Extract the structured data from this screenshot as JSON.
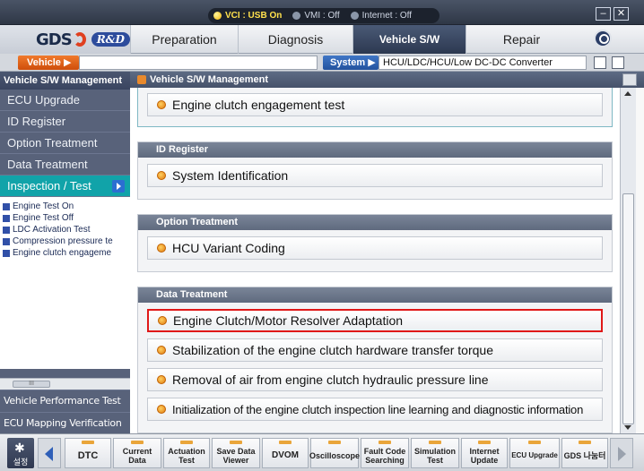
{
  "titlebar": {
    "vci": "VCI : USB On",
    "vmi": "VMI : Off",
    "internet": "Internet : Off",
    "minimize": "–",
    "close": "✕"
  },
  "menubar": {
    "logo": "GDS",
    "logo_badge": "R&D",
    "items": [
      "Preparation",
      "Diagnosis",
      "Vehicle S/W Management",
      "Repair"
    ],
    "active": "Vehicle S/W Management"
  },
  "vehbar": {
    "vehicle_label": "Vehicle ▶",
    "vehicle_value": "",
    "system_label": "System ▶",
    "system_value": "HCU/LDC/HCU/Low DC-DC Converter"
  },
  "sidebar": {
    "header": "Vehicle S/W Management",
    "items": [
      "ECU Upgrade",
      "ID Register",
      "Option Treatment",
      "Data Treatment",
      "Inspection / Test"
    ],
    "active": "Inspection / Test",
    "subitems": [
      "Engine Test On",
      "Engine Test Off",
      "LDC Activation Test",
      "Compression pressure te",
      "Engine clutch engageme"
    ],
    "bottom_items": [
      "Vehicle Performance Test",
      "ECU Mapping Verification"
    ],
    "scroll_label": "III"
  },
  "content": {
    "header": "Vehicle S/W Management",
    "sections": [
      {
        "title": "",
        "rows": [
          "Engine clutch engagement test"
        ]
      },
      {
        "title": "ID Register",
        "rows": [
          "System Identification"
        ]
      },
      {
        "title": "Option Treatment",
        "rows": [
          "HCU Variant Coding"
        ]
      },
      {
        "title": "Data Treatment",
        "rows": [
          "Engine Clutch/Motor Resolver Adaptation",
          "Stabilization of the engine clutch hardware transfer torque",
          "Removal of air from engine clutch hydraulic pressure line",
          "Initialization of the engine clutch inspection line learning and diagnostic information"
        ]
      }
    ],
    "selected_row": "Engine Clutch/Motor Resolver Adaptation"
  },
  "bottombar": {
    "settings_label": "설정",
    "buttons": [
      [
        "DTC"
      ],
      [
        "Current Data"
      ],
      [
        "Actuation",
        "Test"
      ],
      [
        "Save Data",
        "Viewer"
      ],
      [
        "DVOM"
      ],
      [
        "Oscilloscope"
      ],
      [
        "Fault Code",
        "Searching"
      ],
      [
        "Simulation",
        "Test"
      ],
      [
        "Internet",
        "Update"
      ],
      [
        "ECU Upgrade"
      ],
      [
        "GDS 나눔터"
      ]
    ]
  },
  "colors": {
    "active_menu": "#2c3850",
    "sidebar_bg": "#58627a",
    "sidebar_active": "#11a3a9",
    "vehicle_btn": "#e0651a",
    "system_btn": "#2e62b2",
    "selected_outline": "#e01818"
  }
}
